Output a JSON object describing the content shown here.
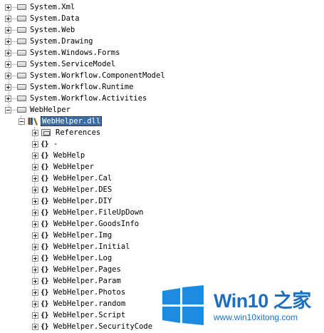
{
  "tree": {
    "top_namespaces": [
      "System.Xml",
      "System.Data",
      "System.Web",
      "System.Drawing",
      "System.Windows.Forms",
      "System.ServiceModel",
      "System.Workflow.ComponentModel",
      "System.Workflow.Runtime",
      "System.Workflow.Activities"
    ],
    "project": "WebHelper",
    "assembly": "WebHelper.dll",
    "references_label": "References",
    "namespace_glyph": "{}",
    "namespaces": [
      "-",
      "WebHelp",
      "WebHelper",
      "WebHelper.Cal",
      "WebHelper.DES",
      "WebHelper.DIY",
      "WebHelper.FileUpDown",
      "WebHelper.GoodsInfo",
      "WebHelper.Img",
      "WebHelper.Initial",
      "WebHelper.Log",
      "WebHelper.Pages",
      "WebHelper.Param",
      "WebHelper.Photos",
      "WebHelper.random",
      "WebHelper.Script",
      "WebHelper.SecurityCode"
    ]
  },
  "watermark": {
    "title": "Win10 之家",
    "url": "www.win10xitong.com"
  },
  "colors": {
    "selection": "#3a6ea5",
    "watermark_blue": "#1d6fc2"
  }
}
